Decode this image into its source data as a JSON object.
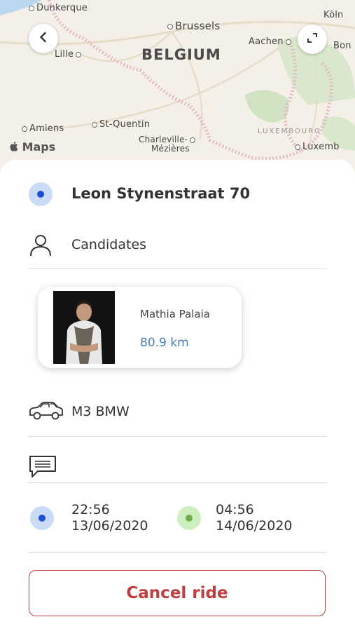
{
  "map": {
    "attribution": "Maps",
    "country_label": "BELGIUM",
    "country_label_small": "LUXEMBOURG",
    "cities": {
      "dunkerque": "Dunkerque",
      "brussels": "Brussels",
      "koln": "Köln",
      "lille": "Lille",
      "aachen": "Aachen",
      "bonn": "Bon",
      "amiens": "Amiens",
      "st_quentin": "St-Quentin",
      "charleville": "Charleville-",
      "mezieres": "Mézières",
      "luxembourg_city": "Luxemb"
    },
    "back_icon": "chevron-left-icon",
    "expand_icon": "expand-icon"
  },
  "ride": {
    "address": "Leon Stynenstraat 70",
    "candidates_label": "Candidates",
    "candidate": {
      "name": "Mathia Palaia",
      "distance": "80.9 km"
    },
    "car": "M3 BMW",
    "message": "",
    "start": {
      "time": "22:56",
      "date": "13/06/2020"
    },
    "end": {
      "time": "04:56",
      "date": "14/06/2020"
    },
    "cancel_label": "Cancel ride"
  },
  "colors": {
    "accent_blue": "#1a4fd6",
    "accent_green": "#6ab04c",
    "cancel_red": "#c43d3d",
    "distance_blue": "#4a7fc1"
  }
}
